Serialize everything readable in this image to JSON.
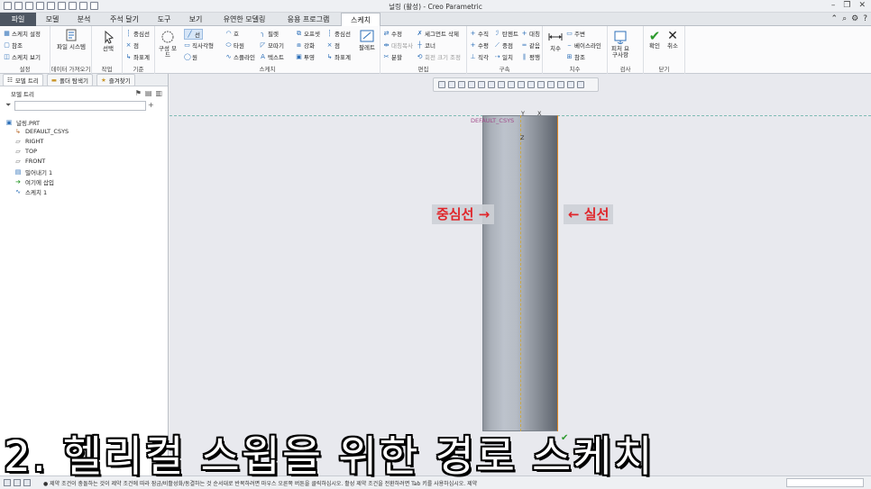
{
  "window": {
    "title": "널링 (활성) - Creo Parametric"
  },
  "tabs": [
    {
      "label": "파일"
    },
    {
      "label": "모델"
    },
    {
      "label": "분석"
    },
    {
      "label": "주석 달기"
    },
    {
      "label": "도구"
    },
    {
      "label": "보기"
    },
    {
      "label": "유연한 모델링"
    },
    {
      "label": "응용 프로그램"
    },
    {
      "label": "스케치"
    }
  ],
  "ribbon": {
    "setup": {
      "sketch_setup": "스케치 설정",
      "reference": "참조",
      "sketch_view": "스케치 보기",
      "label": "설정"
    },
    "data": {
      "file_system": "파일 시스템",
      "label": "데이터 가져오기"
    },
    "operations": {
      "select": "선택",
      "label": "작업"
    },
    "datum": {
      "centerline": "중심선",
      "point": "점",
      "csys": "좌표계",
      "label": "기준"
    },
    "sketching": {
      "construction_mode": "구성 모드",
      "line": "선",
      "rectangle": "직사각형",
      "circle": "원",
      "arc": "호",
      "ellipse": "타원",
      "spline": "스플라인",
      "fillet": "필렛",
      "chamfer": "모따기",
      "text": "텍스트",
      "offset": "오프셋",
      "thicken": "강화",
      "project": "투영",
      "centerline": "중심선",
      "point": "점",
      "csys": "좌표계",
      "palette": "팔레트",
      "label": "스케치"
    },
    "editing": {
      "modify": "수정",
      "mirror": "대칭복사",
      "divide": "분할",
      "delete_segment": "세그먼트 삭제",
      "corner": "코너",
      "rotate_resize": "회전 크기 조정",
      "label": "편집"
    },
    "constrain": {
      "vertical": "수직",
      "horizontal": "수평",
      "perpendicular": "직각",
      "tangent": "탄젠트",
      "midpoint": "중점",
      "coincident": "일치",
      "symmetric": "대칭",
      "equal": "같음",
      "parallel": "평행",
      "label": "구속"
    },
    "dimension": {
      "dimension": "치수",
      "perimeter": "주변",
      "baseline": "베이스라인",
      "reference": "참조",
      "label": "치수"
    },
    "inspect": {
      "feature_requirements": "피처 요구사항",
      "label": "검사"
    },
    "close": {
      "ok": "확인",
      "cancel": "취소",
      "label": "닫기"
    }
  },
  "panel": {
    "tabs": [
      "모델 트리",
      "폴더 탐색기",
      "즐겨찾기"
    ],
    "header": "모델 트리",
    "tree": [
      {
        "label": "널링.PRT",
        "icon": "part-icon"
      },
      {
        "label": "DEFAULT_CSYS",
        "icon": "csys-icon"
      },
      {
        "label": "RIGHT",
        "icon": "plane-icon"
      },
      {
        "label": "TOP",
        "icon": "plane-icon"
      },
      {
        "label": "FRONT",
        "icon": "plane-icon"
      },
      {
        "label": "밀어내기 1",
        "icon": "extrude-icon"
      },
      {
        "label": "여기에 삽입",
        "icon": "insert-arrow-icon"
      },
      {
        "label": "스케치 1",
        "icon": "sketch-icon"
      }
    ]
  },
  "graphics": {
    "csys_label": "DEFAULT_CSYS",
    "axes": {
      "y": "Y",
      "x": "X",
      "z": "Z"
    },
    "centerline_annotation": "중심선 →",
    "solid_line_annotation": "← 실선"
  },
  "status": {
    "message": "● 제약 조건이 충돌하는 것이 제약 조건에 따라 잠금/비활성화/동결하는 것 순서대로 반복하려면 마우스 오른쪽 버튼을 클릭하십시오. 활성 제약 조건을 전환하려면 Tab 키를 사용하십시오. 제약"
  },
  "caption": "2. 헬리컬 스윕을 위한 경로 스케치",
  "colors": {
    "accent_red": "#e0252a",
    "file_tab": "#4d5662",
    "centerline": "#c8a64a",
    "solid_line": "#e08a2a"
  }
}
